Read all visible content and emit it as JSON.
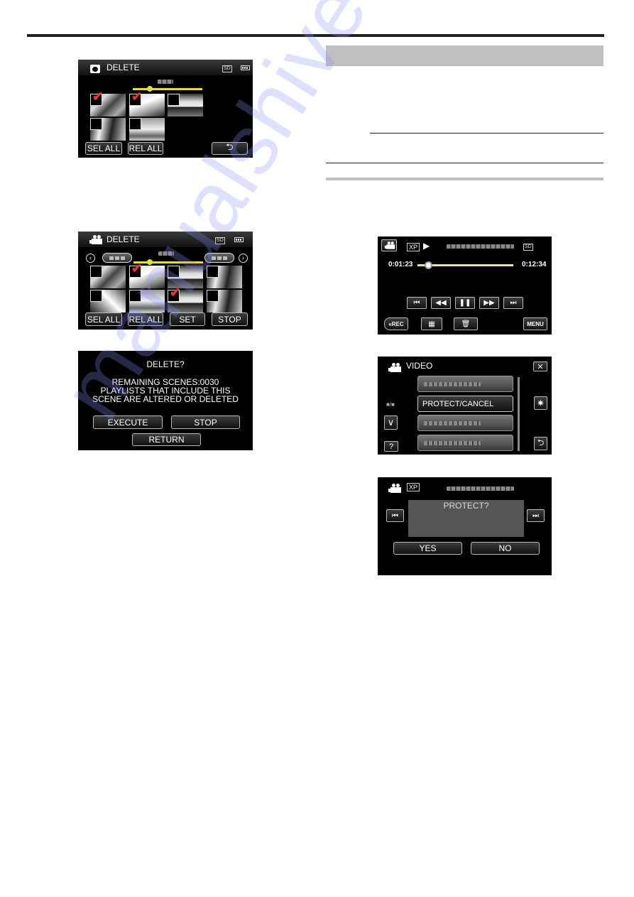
{
  "page": {
    "watermark": "manualshive.com"
  },
  "screens": {
    "photo_delete": {
      "title": "DELETE",
      "storage": "SD",
      "thumbnails_checked": [
        true,
        true,
        false,
        false,
        false
      ],
      "buttons": {
        "sel_all": "SEL ALL",
        "rel_all": "REL ALL"
      }
    },
    "video_delete": {
      "title": "DELETE",
      "storage": "SD",
      "thumbnails_checked": [
        false,
        true,
        false,
        false,
        false,
        false,
        true,
        false
      ],
      "buttons": {
        "sel_all": "SEL ALL",
        "rel_all": "REL ALL",
        "set": "SET",
        "stop": "STOP"
      }
    },
    "delete_confirm": {
      "title": "DELETE?",
      "line1": "REMAINING SCENES:0030",
      "line2": "PLAYLISTS THAT INCLUDE THIS",
      "line3": "SCENE ARE ALTERED OR DELETED",
      "buttons": {
        "execute": "EXECUTE",
        "stop": "STOP",
        "return": "RETURN"
      }
    },
    "playback": {
      "quality": "XP",
      "storage": "SD",
      "elapsed": "0:01:23",
      "total": "0:12:34",
      "progress": 0.11,
      "buttons": {
        "rec": "«REC",
        "menu": "MENU"
      }
    },
    "video_menu": {
      "title": "VIDEO",
      "page_indicator": "■/■",
      "items": [
        "",
        "PROTECT/CANCEL",
        "",
        ""
      ],
      "selected_index": 1,
      "help_label": "?"
    },
    "protect_confirm": {
      "quality": "XP",
      "message": "PROTECT?",
      "buttons": {
        "yes": "YES",
        "no": "NO"
      }
    }
  }
}
